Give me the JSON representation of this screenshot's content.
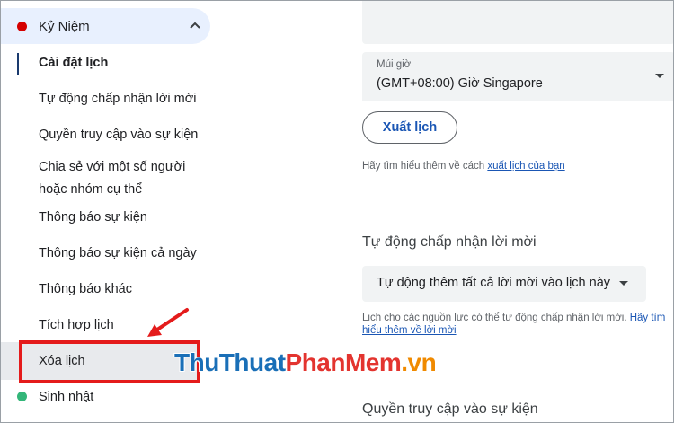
{
  "sidebar": {
    "calendar": {
      "name": "Kỷ Niệm",
      "color": "#d50000"
    },
    "items": [
      {
        "label": "Cài đặt lịch"
      },
      {
        "label": "Tự động chấp nhận lời mời"
      },
      {
        "label": "Quyền truy cập vào sự kiện"
      },
      {
        "label_line1": "Chia sẻ với một số người",
        "label_line2": "hoặc nhóm cụ thể"
      },
      {
        "label": "Thông báo sự kiện"
      },
      {
        "label": "Thông báo sự kiện cả ngày"
      },
      {
        "label": "Thông báo khác"
      },
      {
        "label": "Tích hợp lịch"
      },
      {
        "label": "Xóa lịch"
      }
    ],
    "other_calendar": {
      "name": "Sinh nhật",
      "color": "#33b679"
    }
  },
  "watermark": {
    "part1": "ThuThuat",
    "part2": "PhanMem",
    "part3": ".vn"
  },
  "main": {
    "timezone": {
      "label": "Múi giờ",
      "value": "(GMT+08:00) Giờ Singapore"
    },
    "export_button": "Xuất lịch",
    "export_hint_prefix": "Hãy tìm hiểu thêm về cách ",
    "export_hint_link": "xuất lịch của bạn",
    "auto_accept": {
      "title": "Tự động chấp nhận lời mời",
      "selected": "Tự động thêm tất cả lời mời vào lịch này",
      "hint_text": "Lịch cho các nguồn lực có thể tự động chấp nhận lời mời. ",
      "hint_link": "Hãy tìm hiểu thêm về lời mời"
    },
    "access": {
      "title": "Quyền truy cập vào sự kiện"
    }
  }
}
